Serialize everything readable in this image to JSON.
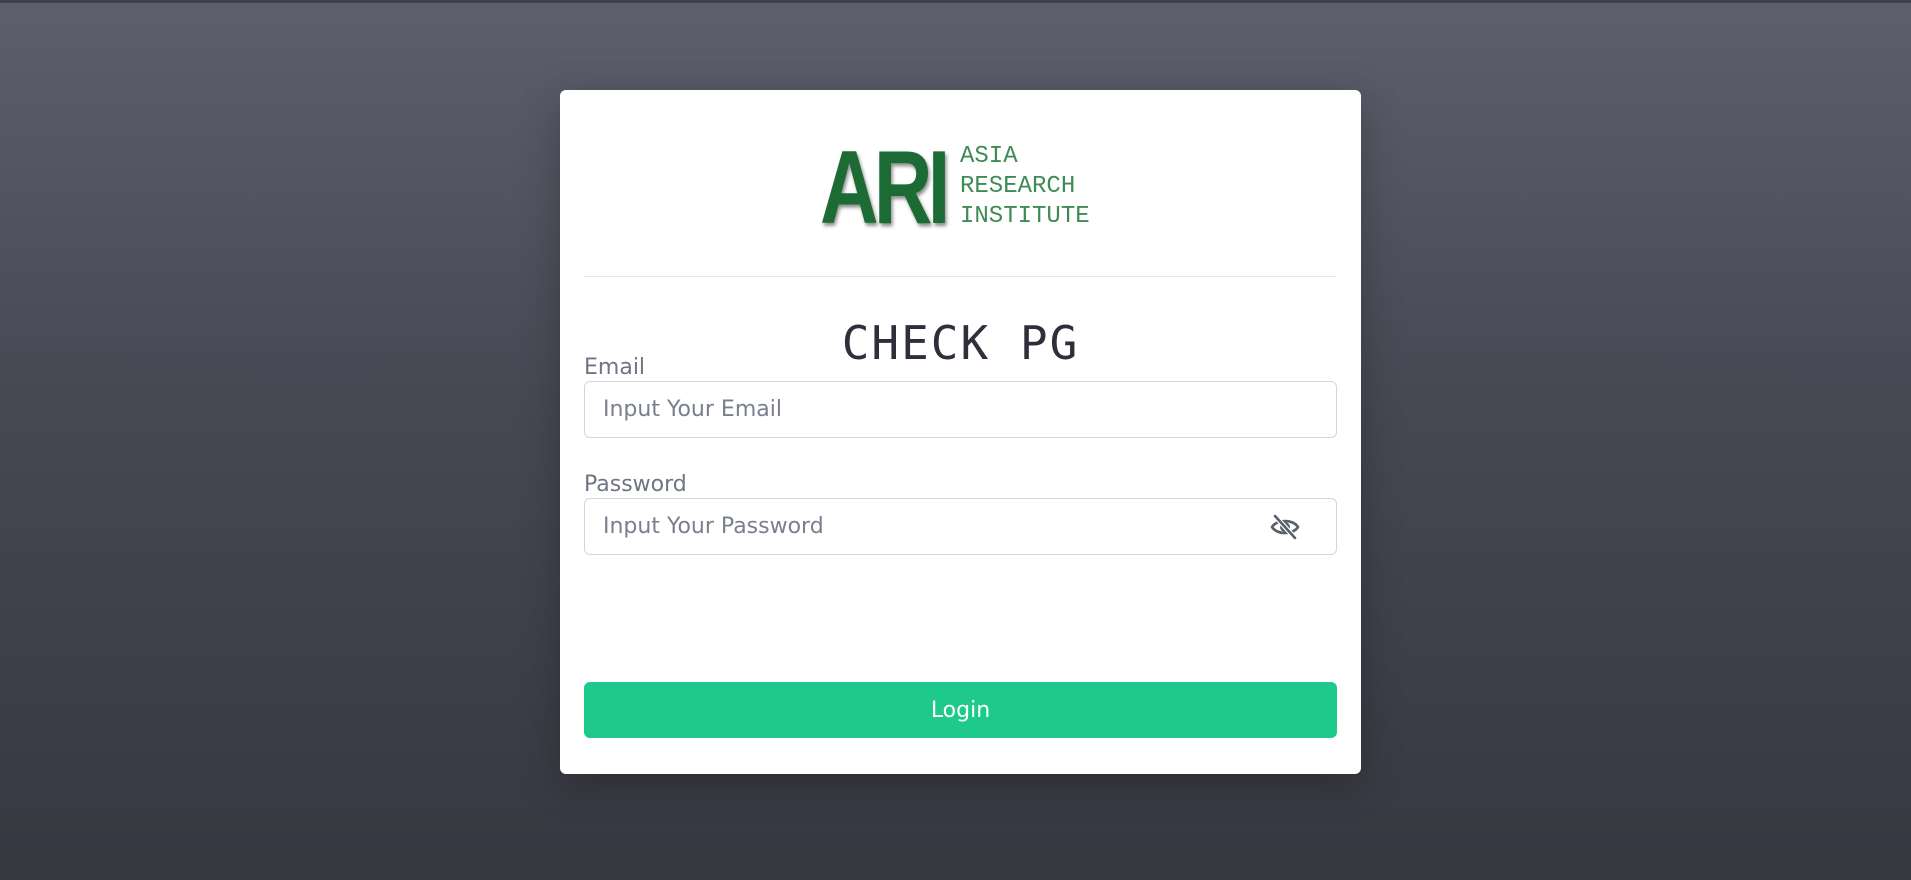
{
  "logo": {
    "big_text": "ARI",
    "lines": [
      "ASIA",
      "RESEARCH",
      "INSTITUTE"
    ],
    "color": "#1c6b35",
    "line_color": "#3f8a55"
  },
  "title": "CHECK PG",
  "email": {
    "label": "Email",
    "placeholder": "Input Your Email",
    "value": ""
  },
  "password": {
    "label": "Password",
    "placeholder": "Input Your Password",
    "value": "",
    "toggle_icon": "eye-slash-icon"
  },
  "login_button": {
    "label": "Login",
    "color": "#1ec98c"
  }
}
